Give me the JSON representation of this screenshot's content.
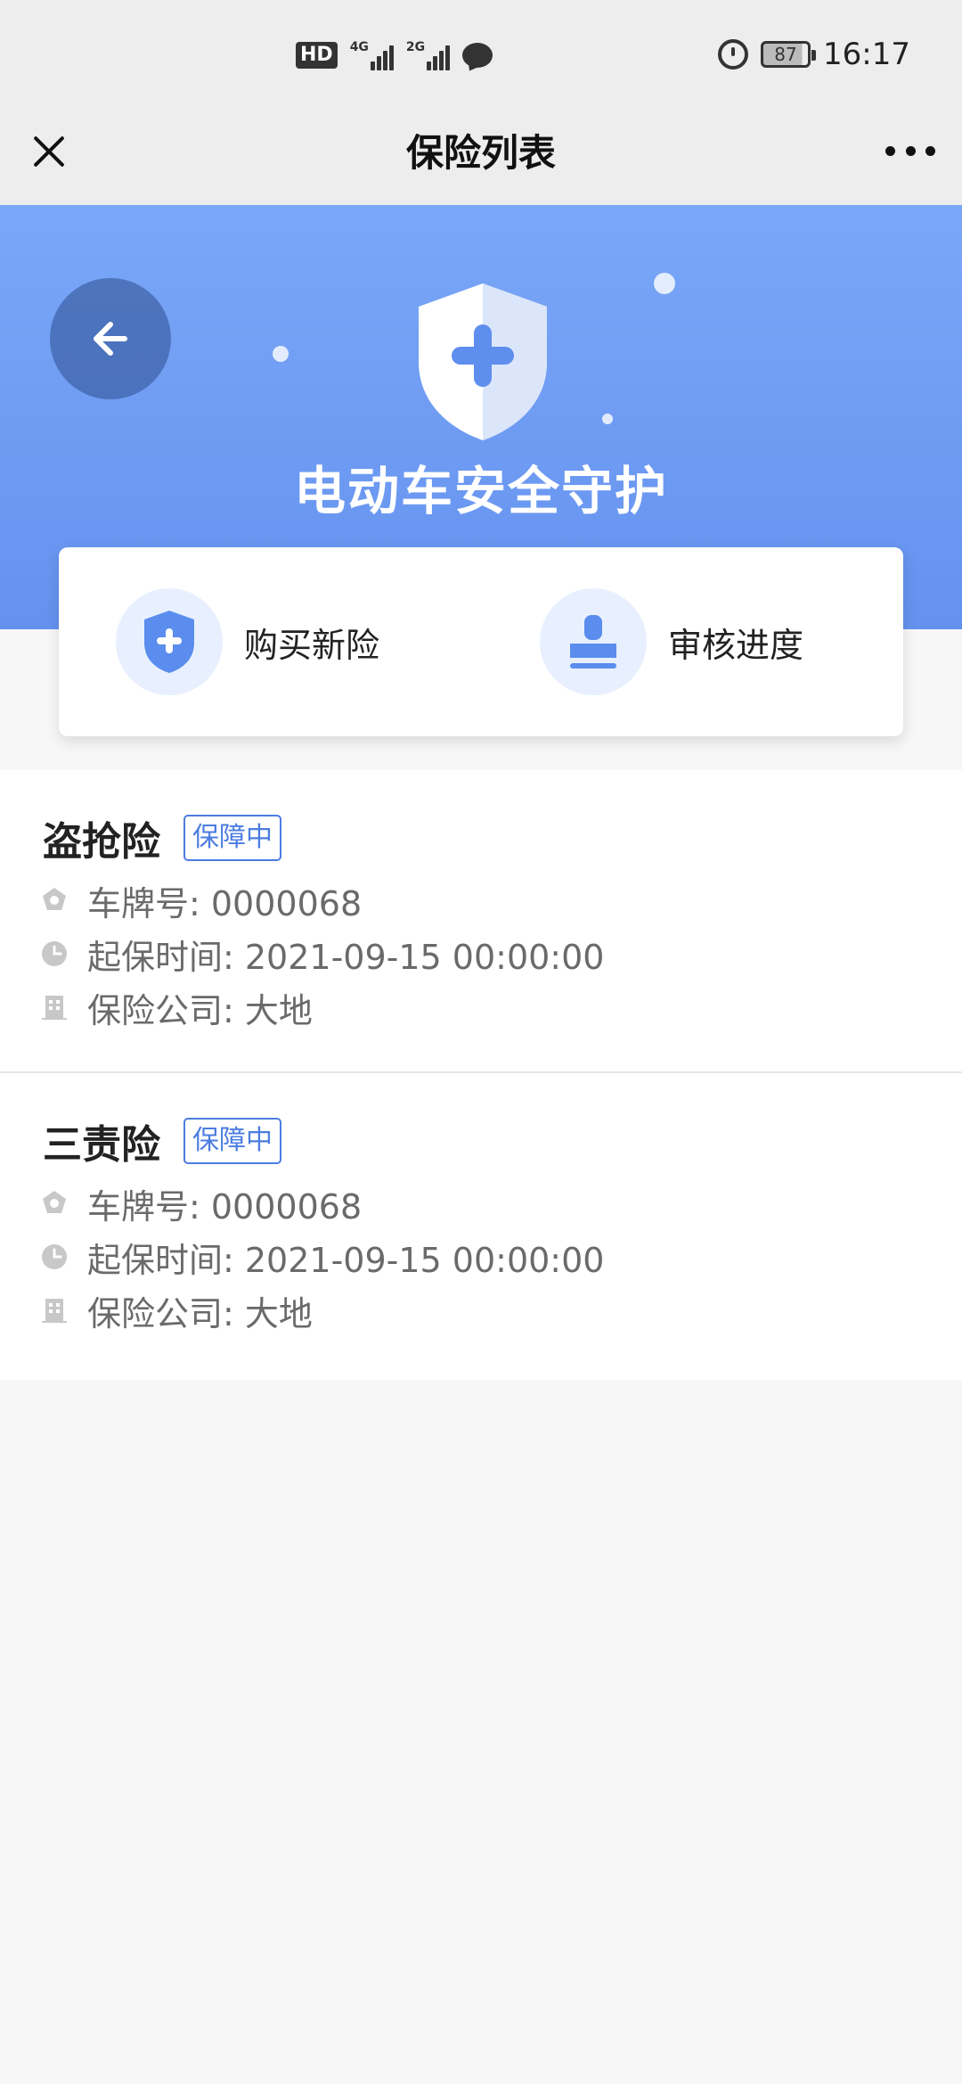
{
  "status_bar": {
    "hd_label": "HD",
    "signal_1_label": "4G",
    "signal_2_label": "2G",
    "battery_level": "87",
    "time": "16:17"
  },
  "nav": {
    "title": "保险列表"
  },
  "banner": {
    "title": "电动车安全守护"
  },
  "actions": {
    "buy_label": "购买新险",
    "review_label": "审核进度"
  },
  "policies": [
    {
      "name": "盗抢险",
      "status": "保障中",
      "plate_label": "车牌号: 0000068",
      "start_label": "起保时间: 2021-09-15 00:00:00",
      "company_label": "保险公司: 大地"
    },
    {
      "name": "三责险",
      "status": "保障中",
      "plate_label": "车牌号: 0000068",
      "start_label": "起保时间: 2021-09-15 00:00:00",
      "company_label": "保险公司: 大地"
    }
  ],
  "colors": {
    "accent": "#4c7de0",
    "banner_top": "#7aa7f7",
    "banner_bottom": "#6592ef"
  }
}
